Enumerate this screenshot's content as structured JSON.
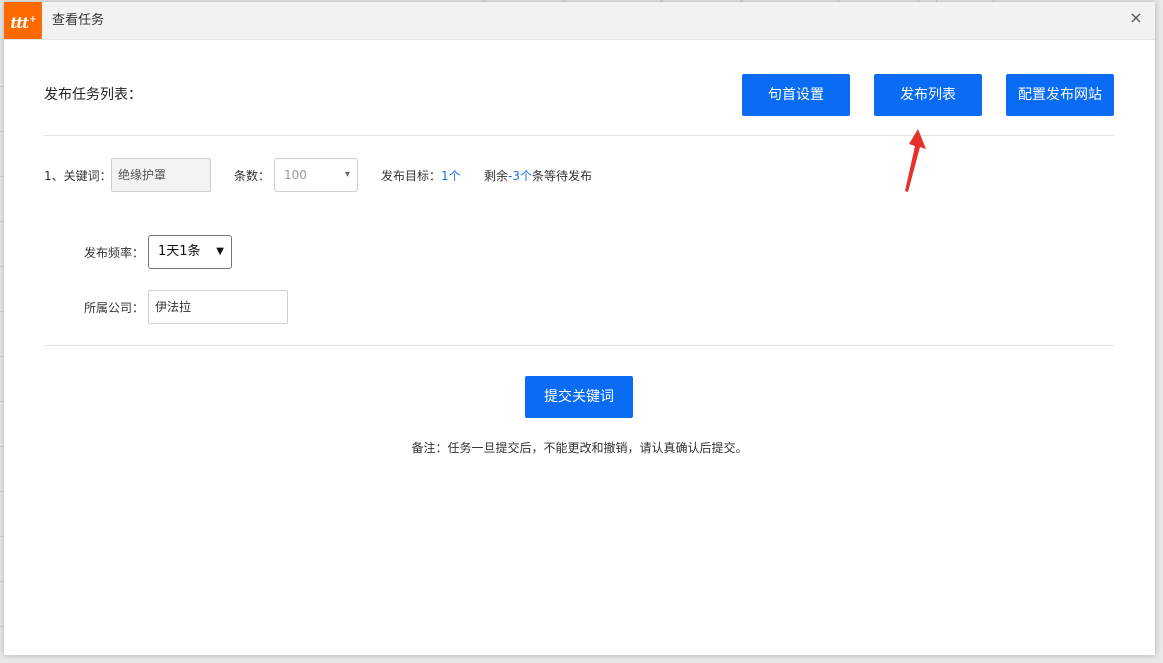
{
  "dialog": {
    "logo_text": "ttt",
    "logo_sup": "+",
    "title": "查看任务",
    "close_glyph": "×"
  },
  "header": {
    "section_title": "发布任务列表：",
    "buttons": {
      "sentence_head": "句首设置",
      "publish_list": "发布列表",
      "config_site": "配置发布网站"
    }
  },
  "task_row": {
    "keyword_label": "1、关键词：",
    "keyword_value": "绝缘护罩",
    "count_label": "条数：",
    "count_value": "100",
    "target_label": "发布目标：",
    "target_value": "1个",
    "remain_prefix": "剩余",
    "remain_value": "-3个",
    "remain_suffix": "条等待发布"
  },
  "settings": {
    "frequency_label": "发布频率：",
    "frequency_value": "1天1条",
    "company_label": "所属公司：",
    "company_value": "伊法拉"
  },
  "submit": {
    "label": "提交关键词",
    "note": "备注：任务一旦提交后，不能更改和撤销，请认真确认后提交。"
  },
  "colors": {
    "accent": "#0a6cf5",
    "logo": "#ff6a00",
    "annotation_arrow": "#e8302a",
    "link": "#1a73e8"
  },
  "icons": {
    "close": "close-icon",
    "dropdown": "chevron-down-icon",
    "annotation": "red-arrow-icon"
  }
}
